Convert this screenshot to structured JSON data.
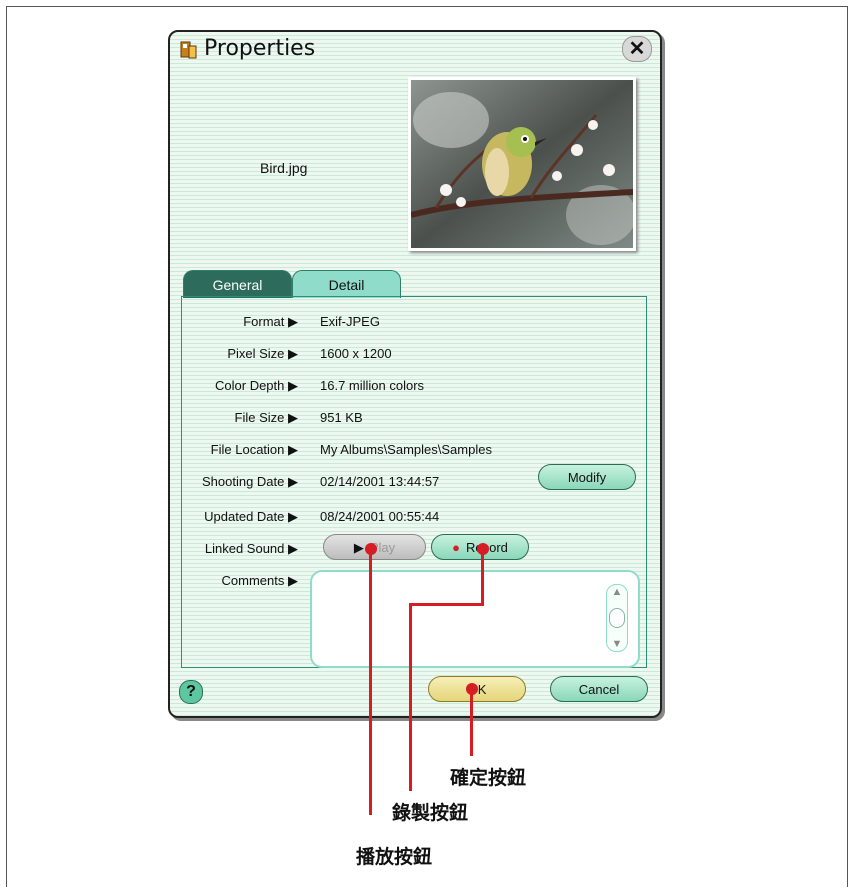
{
  "dialog": {
    "title": "Properties",
    "close_icon": "✕",
    "filename": "Bird.jpg",
    "tabs": [
      {
        "label": "General"
      },
      {
        "label": "Detail"
      }
    ],
    "rows": [
      {
        "label": "Format ▶",
        "value": "Exif-JPEG"
      },
      {
        "label": "Pixel Size ▶",
        "value": "1600 x 1200"
      },
      {
        "label": "Color Depth ▶",
        "value": "16.7 million colors"
      },
      {
        "label": "File Size ▶",
        "value": "951 KB"
      },
      {
        "label": "File Location ▶",
        "value": "My Albums\\Samples\\Samples"
      },
      {
        "label": "Shooting Date ▶",
        "value": "02/14/2001 13:44:57"
      },
      {
        "label": "Updated Date ▶",
        "value": "08/24/2001 00:55:44"
      },
      {
        "label": "Linked Sound ▶",
        "value": ""
      },
      {
        "label": "Comments ▶",
        "value": ""
      }
    ],
    "modify_label": "Modify",
    "play_label": "Play",
    "record_label": "Record",
    "help_label": "?",
    "ok_label": "OK",
    "cancel_label": "Cancel"
  },
  "annotations": {
    "ok": "確定按鈕",
    "record": "錄製按鈕",
    "play": "播放按鈕"
  },
  "colors": {
    "callout": "#d51d23",
    "tab_active": "#2d6b5c",
    "tab_inactive": "#8fdccb",
    "button_green": "#8ad7b9",
    "ok_yellow": "#e5d57a"
  }
}
